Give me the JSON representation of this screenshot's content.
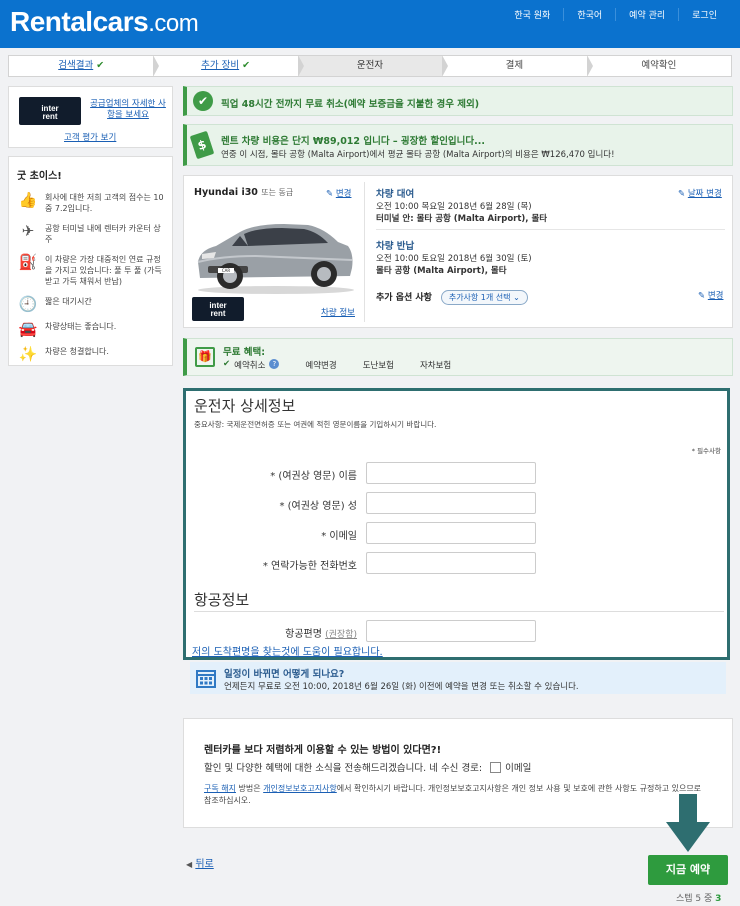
{
  "header": {
    "logo_main": "Rentalcars",
    "logo_tld": ".com",
    "nav": [
      "한국 원화",
      "한국어",
      "예약 관리",
      "로그인"
    ]
  },
  "steps": [
    {
      "label": "검색결과",
      "state": "done"
    },
    {
      "label": "추가 장비",
      "state": "done"
    },
    {
      "label": "운전자",
      "state": "active"
    },
    {
      "label": "결제",
      "state": "todo"
    },
    {
      "label": "예약확인",
      "state": "todo"
    }
  ],
  "sidebar": {
    "supplier_logo_top": "inter",
    "supplier_logo_bottom": "rent",
    "supplier_link": "공급업체의 자세한 사항을 보세요",
    "reviews_link": "고객 평가 보기",
    "good_choice_title": "굿 초이스!",
    "good_items": [
      {
        "icon": "thumbs-up-icon",
        "glyph": "👍",
        "text": "회사에 대한 저희 고객의 점수는 10 중 7.2입니다."
      },
      {
        "icon": "airplane-icon",
        "glyph": "✈",
        "text": "공항 터미널 내에 렌터카 카운터 상주"
      },
      {
        "icon": "fuel-icon",
        "glyph": "⛽",
        "text": "이 차량은 가장 대중적인 연료 규정을 가지고 있습니다: 풀 투 풀 (가득 받고 가득 채워서 반납)"
      },
      {
        "icon": "clock-icon",
        "glyph": "🕘",
        "text": "짧은 대기시간"
      },
      {
        "icon": "car-icon",
        "glyph": "🚘",
        "text": "차량상태는 좋습니다."
      },
      {
        "icon": "sparkle-icon",
        "glyph": "✨",
        "text": "차량은 청결합니다."
      }
    ]
  },
  "cancel_notice": "픽업 48시간 전까지 무료 취소(예약 보증금을 지불한 경우 제외)",
  "price_notice": {
    "title": "렌트 차량 비용은 단지 ₩89,012 입니다 – 굉장한 할인입니다...",
    "body": "연중 이 시점, 몰타 공항 (Malta Airport)에서 평균 몰타 공항 (Malta Airport)의 비용은 ₩126,470 입니다!"
  },
  "car": {
    "name": "Hyundai i30",
    "or_similar": "또는 동급",
    "change": "변경",
    "rental_terms": "차량 정보",
    "plate": "CAR"
  },
  "trip": {
    "pickup_title": "차량 대여",
    "pickup_datetime": "오전 10:00 목요일 2018년 6월 28일 (목)",
    "pickup_place": "터미널 안: 몰타 공항 (Malta Airport), 몰타",
    "change_dates": "날짜 변경",
    "return_title": "차량 반납",
    "return_datetime": "오전 10:00 토요일 2018년 6월 30일 (토)",
    "return_place": "몰타 공항 (Malta Airport), 몰타",
    "extras_label": "추가 옵션 사항",
    "extras_pill": "추가사항 1개 선택",
    "extras_change": "변경"
  },
  "free_benefits": {
    "title": "무료 혜택:",
    "items": [
      "예약취소",
      "예약변경",
      "도난보험",
      "자차보험"
    ]
  },
  "driver_form": {
    "title": "운전자 상세정보",
    "note": "중요사항: 국제운전면허증 또는 여권에 적힌 영문이름을 기입하시기 바랍니다.",
    "required": "* 필수사항",
    "fields": [
      {
        "label": "* (여권상 영문) 이름",
        "value": ""
      },
      {
        "label": "* (여권상 영문) 성",
        "value": ""
      },
      {
        "label": "* 이메일",
        "value": ""
      },
      {
        "label": "* 연락가능한 전화번호",
        "value": ""
      }
    ],
    "flight_title": "항공정보",
    "flight_label": "항공편명",
    "flight_recommended": "(권장함)",
    "flight_help": "저의 도착편명을 찾는것에 도움이 필요합니다."
  },
  "plan_change": {
    "title": "일정이 바뀌면 어떻게 되나요?",
    "body": "언제든지 무료로 오전 10:00, 2018년 6월 26일 (화) 이전에 예약을 변경 또는 취소할 수 있습니다."
  },
  "newsletter": {
    "title": "렌터카를 보다 저렴하게 이용할 수 있는 방법이 있다면?!",
    "text": "할인 및 다양한 혜택에 대한 소식을 전송해드리겠습니다. 네 수신 경로:",
    "option": "이메일",
    "unsub_link": "구독 해지",
    "unsub_mid": "방법은",
    "privacy_link": "개인정보보호고지사항",
    "privacy_rest": "에서 확인하시기 바랍니다. 개인정보보호고지사항은 개인 정보 사용 및 보호에 관한 사항도 규정하고 있으므로 참조하십시오."
  },
  "footer": {
    "back": "뒤로",
    "book_now": "지금 예약",
    "step_prefix": "스텝 5 중",
    "step_current": "3"
  },
  "colors": {
    "brand_blue": "#0b72ce",
    "success_green": "#3f9b47",
    "book_green": "#2e9b3e",
    "highlight_teal": "#2e6e70"
  }
}
